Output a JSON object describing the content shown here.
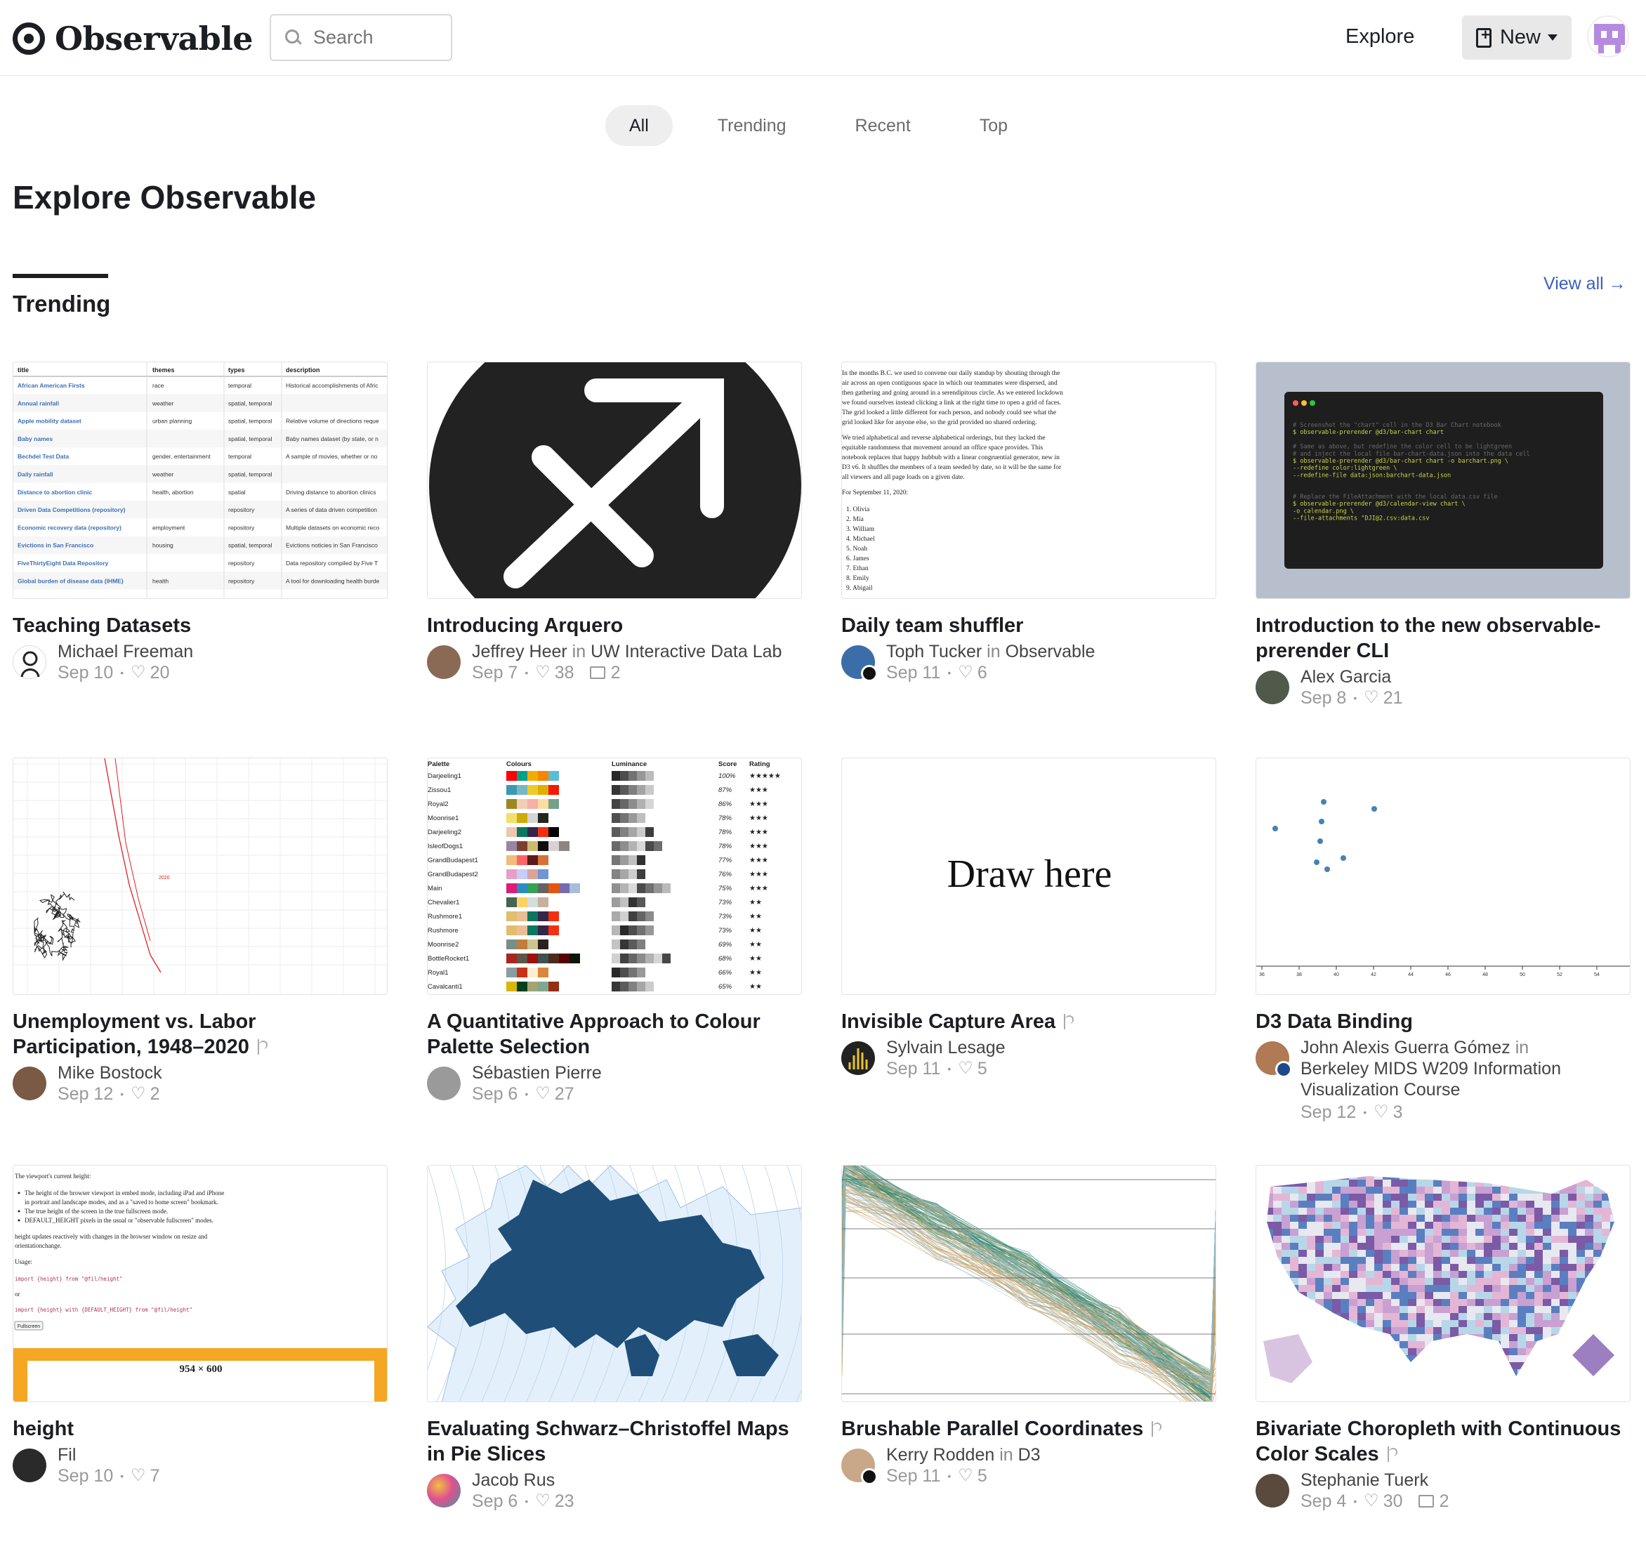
{
  "header": {
    "logo_text": "Observable",
    "search_placeholder": "Search",
    "explore_label": "Explore",
    "new_label": "New"
  },
  "tabs": [
    {
      "label": "All",
      "active": true
    },
    {
      "label": "Trending",
      "active": false
    },
    {
      "label": "Recent",
      "active": false
    },
    {
      "label": "Top",
      "active": false
    }
  ],
  "page_title": "Explore Observable",
  "section": {
    "title": "Trending",
    "view_all": "View all →"
  },
  "cards": [
    {
      "title": "Teaching Datasets",
      "author": "Michael Freeman",
      "org": "",
      "date": "Sep 10",
      "likes": "20",
      "comments": "",
      "fork": false
    },
    {
      "title": "Introducing Arquero",
      "author": "Jeffrey Heer",
      "org": "UW Interactive Data Lab",
      "date": "Sep 7",
      "likes": "38",
      "comments": "2",
      "fork": false
    },
    {
      "title": "Daily team shuffler",
      "author": "Toph Tucker",
      "org": "Observable",
      "date": "Sep 11",
      "likes": "6",
      "comments": "",
      "fork": false
    },
    {
      "title": "Introduction to the new observable-prerender CLI",
      "author": "Alex Garcia",
      "org": "",
      "date": "Sep 8",
      "likes": "21",
      "comments": "",
      "fork": false
    },
    {
      "title": "Unemployment vs. Labor Participation, 1948–2020",
      "author": "Mike Bostock",
      "org": "",
      "date": "Sep 12",
      "likes": "2",
      "comments": "",
      "fork": true
    },
    {
      "title": "A Quantitative Approach to Colour Palette Selection",
      "author": "Sébastien Pierre",
      "org": "",
      "date": "Sep 6",
      "likes": "27",
      "comments": "",
      "fork": false
    },
    {
      "title": "Invisible Capture Area",
      "author": "Sylvain Lesage",
      "org": "",
      "date": "Sep 11",
      "likes": "5",
      "comments": "",
      "fork": true
    },
    {
      "title": "D3 Data Binding",
      "author": "John Alexis Guerra Gómez",
      "org": "Berkeley MIDS W209 Information Visualization Course",
      "date": "Sep 12",
      "likes": "3",
      "comments": "",
      "fork": false
    },
    {
      "title": "height",
      "author": "Fil",
      "org": "",
      "date": "Sep 10",
      "likes": "7",
      "comments": "",
      "fork": false
    },
    {
      "title": "Evaluating Schwarz–Christoffel Maps in Pie Slices",
      "author": "Jacob Rus",
      "org": "",
      "date": "Sep 6",
      "likes": "23",
      "comments": "",
      "fork": false
    },
    {
      "title": "Brushable Parallel Coordinates",
      "author": "Kerry Rodden",
      "org": "D3",
      "date": "Sep 11",
      "likes": "5",
      "comments": "",
      "fork": true
    },
    {
      "title": "Bivariate Choropleth with Continuous Color Scales",
      "author": "Stephanie Tuerk",
      "org": "",
      "date": "Sep 4",
      "likes": "30",
      "comments": "2",
      "fork": true
    }
  ],
  "thumbs": {
    "teaching": {
      "headers": [
        "title",
        "themes",
        "types",
        "description"
      ],
      "rows": [
        [
          "African American Firsts",
          "race",
          "temporal",
          "Historical accomplishments of Afric"
        ],
        [
          "Annual rainfall",
          "weather",
          "spatial, temporal",
          ""
        ],
        [
          "Apple mobility dataset",
          "urban planning",
          "spatial, temporal",
          "Relative volume of directions reque"
        ],
        [
          "Baby names",
          "",
          "spatial, temporal",
          "Baby names dataset (by state, or n"
        ],
        [
          "Bechdel Test Data",
          "gender, entertainment",
          "temporal",
          "A sample of movies, whether or no"
        ],
        [
          "Daily rainfall",
          "weather",
          "spatial, temporal",
          ""
        ],
        [
          "Distance to abortion clinic",
          "health, abortion",
          "spatial",
          "Driving distance to abortion clinics"
        ],
        [
          "Driven Data Competitions (repository)",
          "",
          "repository",
          "A series of data driven competition"
        ],
        [
          "Economic recovery data (repository)",
          "employment",
          "repository",
          "Multiple datasets on economic reco"
        ],
        [
          "Evictions in San Francisco",
          "housing",
          "spatial, temporal",
          "Evictions noticies in San Francisco"
        ],
        [
          "FiveThirtyEight Data Repository",
          "",
          "repository",
          "Data repository compiled by Five T"
        ],
        [
          "Global burden of disease data (IHME)",
          "health",
          "repository",
          "A tool for downloading health burde"
        ]
      ]
    },
    "shuffler": {
      "para1": [
        "In the months B.C. we used to convene our daily standup by shouting through the",
        "air across an open contiguous space in which our teammates were dispersed, and",
        "then gathering and going around in a serendipitous circle. As we entered lockdown",
        "we found ourselves instead clicking a link at the right time to open a grid of faces.",
        "The grid looked a little different for each person, and nobody could see what the",
        "grid looked like for anyone else, so the grid provided no shared ordering."
      ],
      "para2": [
        "We tried alphabetical and reverse alphabetical orderings, but they lacked the",
        "equitable randomness that movement around an office space provides. This",
        "notebook replaces that happy hubbub with a linear congruential generator, new in",
        "D3 v6. It shuffles the members of a team seeded by date, so it will be the same for",
        "all viewers and all page loads on a given date."
      ],
      "list_heading": "For September 11, 2020:",
      "names": [
        "1. Olivia",
        "2. Mia",
        "3. William",
        "4. Michael",
        "5. Noah",
        "6. James",
        "7. Ethan",
        "8. Emily",
        "9. Abigail"
      ]
    },
    "prerender": {
      "lines": [
        "# Screenshot the \"chart\" cell in  the D3 Bar Chart notebook",
        "$ observable-prerender @d3/bar-chart chart",
        "",
        "# Same as above, but redefine the color cell to be lightgreen",
        "# and inject the local file bar-chart-data.json into the data cell",
        "$ observable-prerender @d3/bar-chart chart -o barchart.png \\",
        "    --redefine color:lightgreen \\",
        "    --redefine-file data:json:barchart-data.json",
        "",
        "",
        "# Replace the FileAttachment with the local data.csv file",
        "$ observable-prerender @d3/calendar-view chart \\",
        "    -o calendar.png \\",
        "    --file-attachments \"DJI@2.csv:data.csv"
      ],
      "colors": {
        "bg": "#1e1e1e",
        "comment": "#6a6a6a",
        "command": "#c8d64a",
        "text": "#e0e0e0"
      }
    },
    "unemployment": {
      "label": "2020",
      "line_color": "#e02020"
    },
    "palette": {
      "headers": [
        "Palette",
        "Colours",
        "Luminance",
        "Score",
        "Rating"
      ],
      "rows": [
        {
          "name": "Darjeeling1",
          "score": "100%",
          "rating": "★★★★★",
          "colors": [
            "#ff0000",
            "#00a08a",
            "#f2ad00",
            "#f98400",
            "#5bbcd6"
          ]
        },
        {
          "name": "Zissou1",
          "score": "87%",
          "rating": "★★★",
          "colors": [
            "#3b9ab2",
            "#78b7c5",
            "#ebcc2a",
            "#e1af00",
            "#f21a00"
          ]
        },
        {
          "name": "Royal2",
          "score": "86%",
          "rating": "★★★",
          "colors": [
            "#9a8822",
            "#f5cdb4",
            "#f8afa8",
            "#fddda0",
            "#74a089"
          ]
        },
        {
          "name": "Moonrise1",
          "score": "78%",
          "rating": "★★★",
          "colors": [
            "#f3df6c",
            "#ceab07",
            "#d5d5d3",
            "#24281a"
          ]
        },
        {
          "name": "Darjeeling2",
          "score": "78%",
          "rating": "★★★",
          "colors": [
            "#ecc8ae",
            "#0b775e",
            "#35274a",
            "#f2300f",
            "#000000"
          ]
        },
        {
          "name": "IsleofDogs1",
          "score": "78%",
          "rating": "★★★",
          "colors": [
            "#9986a5",
            "#79402e",
            "#ccba72",
            "#0f0d0e",
            "#d9d0d3",
            "#8d8680"
          ]
        },
        {
          "name": "GrandBudapest1",
          "score": "77%",
          "rating": "★★★",
          "colors": [
            "#f1bb7b",
            "#fd6467",
            "#5b1a18",
            "#d67236"
          ]
        },
        {
          "name": "GrandBudapest2",
          "score": "76%",
          "rating": "★★★",
          "colors": [
            "#e6a0c4",
            "#c6cdf7",
            "#d8a499",
            "#7294d4"
          ]
        },
        {
          "name": "Main",
          "score": "75%",
          "rating": "★★★",
          "colors": [
            "#dd1c77",
            "#2b8cbe",
            "#31a354",
            "#636363",
            "#e6550d",
            "#756bb1",
            "#a6bddb"
          ]
        },
        {
          "name": "Chevalier1",
          "score": "73%",
          "rating": "★★",
          "colors": [
            "#446455",
            "#fdd262",
            "#d3dddc",
            "#c7b19c"
          ]
        },
        {
          "name": "Rushmore1",
          "score": "73%",
          "rating": "★★",
          "colors": [
            "#e1bd6d",
            "#eabe94",
            "#0b775e",
            "#35274a",
            "#f2300f"
          ]
        },
        {
          "name": "Rushmore",
          "score": "73%",
          "rating": "★★",
          "colors": [
            "#e1bd6d",
            "#eabe94",
            "#0b775e",
            "#35274a",
            "#f2300f"
          ]
        },
        {
          "name": "Moonrise2",
          "score": "69%",
          "rating": "★★",
          "colors": [
            "#798e87",
            "#c27d38",
            "#ccc591",
            "#29211f"
          ]
        },
        {
          "name": "BottleRocket1",
          "score": "68%",
          "rating": "★★",
          "colors": [
            "#a42820",
            "#5f5647",
            "#9b110e",
            "#3f5151",
            "#4e2a1e",
            "#550307",
            "#0c1707"
          ]
        },
        {
          "name": "Royal1",
          "score": "66%",
          "rating": "★★",
          "colors": [
            "#899da4",
            "#c93312",
            "#faefd1",
            "#dc863b"
          ]
        },
        {
          "name": "Cavalcanti1",
          "score": "65%",
          "rating": "★★",
          "colors": [
            "#d8b70a",
            "#02401b",
            "#a2a475",
            "#81a88d",
            "#972d15"
          ]
        }
      ]
    },
    "draw": {
      "text": "Draw here"
    },
    "binding": {
      "ticks": [
        "36",
        "38",
        "40",
        "42",
        "44",
        "46",
        "48",
        "50",
        "52",
        "54"
      ],
      "dot_color": "#4682b4"
    },
    "height": {
      "intro": "The viewport's current height:",
      "bullets": [
        "The height of the browser viewport in embed mode, including iPad and iPhone",
        "in portrait and landscape modes, and as a \"saved to home screen\" bookmark.",
        "The true height of the screen in the true fullscreen mode.",
        "DEFAULT_HEIGHT pixels in the usual or \"observable fullscreen\" modes."
      ],
      "note": [
        "height updates reactively with changes in the browser window on resize and",
        "orientationchange."
      ],
      "usage": "Usage:",
      "code1": "import {height} from \"@fil/height\"",
      "or": "or",
      "code2": "import {height} with {DEFAULT_HEIGHT} from \"@fil/height\"",
      "button": "Fullscreen",
      "size": "954 × 600",
      "frame_color": "#f5a623"
    },
    "maps": {
      "land_color": "#1f4e79",
      "sea_color": "#e3f0fb"
    },
    "parallel": {
      "colors": [
        "#2e8b7a",
        "#c8a060",
        "#8fb8c8"
      ]
    },
    "choropleth": {
      "colors": [
        "#e8e8f0",
        "#c9a0d2",
        "#7b5aa6",
        "#5a7fc0",
        "#b7d7e8",
        "#e4b6d6"
      ]
    }
  }
}
